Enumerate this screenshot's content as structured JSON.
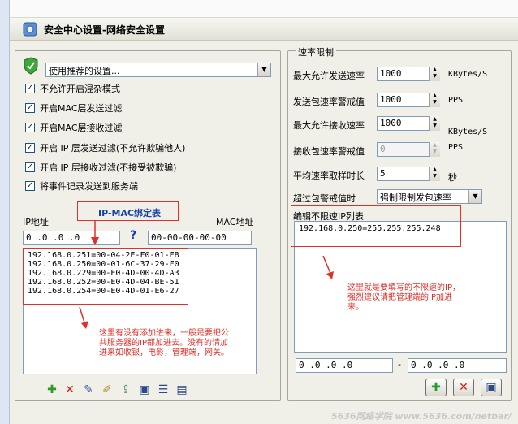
{
  "window": {
    "title": "安全中心设置-网络安全设置"
  },
  "left": {
    "preset": {
      "value": "使用推荐的设置..."
    },
    "options": [
      {
        "label": "不允许开启混杂模式",
        "checked": true
      },
      {
        "label": "开启MAC层发送过滤",
        "checked": true
      },
      {
        "label": "开启MAC层接收过滤",
        "checked": true
      },
      {
        "label": "开启 IP 层发送过滤(不允许欺骗他人)",
        "checked": true
      },
      {
        "label": "开启 IP 层接收过滤(不接受被欺骗)",
        "checked": true
      },
      {
        "label": "将事件记录发送到服务端",
        "checked": true
      }
    ],
    "ip_label": "IP地址",
    "mac_label": "MAC地址",
    "table_title": "IP-MAC绑定表",
    "ip_input": "0  .0  .0  .0",
    "mac_input": "00-00-00-00-00",
    "help": "?",
    "bindings": [
      "192.168.0.251=00-04-2E-F0-01-EB",
      "192.168.0.250=00-01-6C-37-29-F0",
      "192.168.0.229=00-E0-4D-00-4D-A3",
      "192.168.0.252=00-E0-4D-04-BE-51",
      "192.168.0.254=00-E0-4D-01-E6-27"
    ],
    "annotation": "这里有没有添加进来，一般是要把公共服务器的IP都加进去。没有的请加进来如收银，电影，管理端，网关。"
  },
  "right": {
    "legend": "速率限制",
    "rows": [
      {
        "label": "最大允许发送速率",
        "value": "1000",
        "unit": "KBytes/S",
        "disabled": false
      },
      {
        "label": "发送包速率警戒值",
        "value": "1000",
        "unit": "PPS",
        "disabled": false
      },
      {
        "label": "最大允许接收速率",
        "value": "1000",
        "unit": "KBytes/S",
        "disabled": false
      },
      {
        "label": "接收包速率警戒值",
        "value": "0",
        "unit": "PPS",
        "disabled": true
      },
      {
        "label": "平均速率取样时长",
        "value": "5",
        "unit": "秒",
        "disabled": false
      }
    ],
    "exceed_label": "超过包警戒值时",
    "exceed_value": "强制限制发包速率",
    "whitelist_title": "编辑不限速IP列表",
    "whitelist": [
      "192.168.0.250=255.255.255.248"
    ],
    "annotation": "这里就是要填写的不限速的IP，强烈建议请把管理端的IP加进来。",
    "ip_from": "0  .0  .0  .0",
    "ip_to": "0  .0  .0  .0",
    "dash": "-"
  },
  "watermark": "5636网络学院 www.5636.com/netbar/",
  "colors": {
    "annotation": "#e0302a",
    "title_blue": "#1540a8"
  }
}
